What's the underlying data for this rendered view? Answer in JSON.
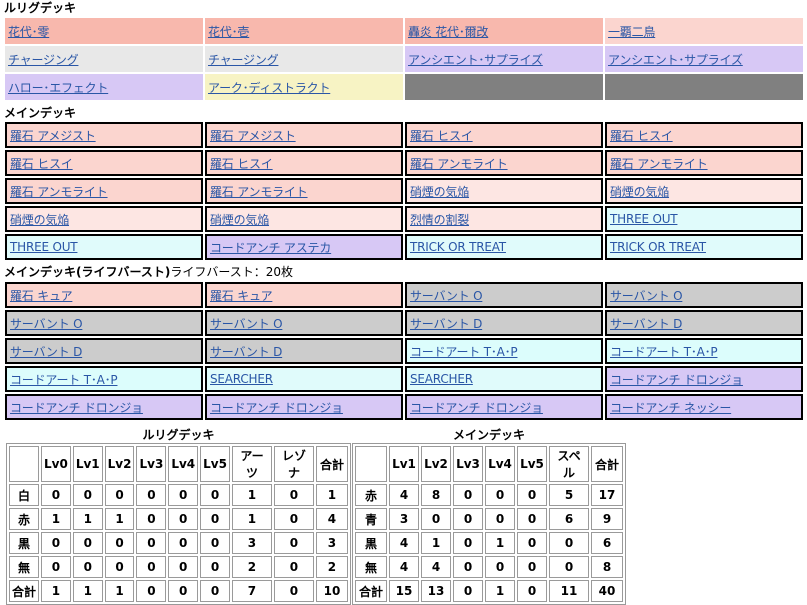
{
  "lrig": {
    "title": "ルリグデッキ",
    "rows": [
      [
        {
          "label": "花代･零",
          "color": "red"
        },
        {
          "label": "花代･壱",
          "color": "red"
        },
        {
          "label": "轟炎 花代･爾改",
          "color": "red"
        },
        {
          "label": "一覇二鳥",
          "color": "lred"
        }
      ],
      [
        {
          "label": "チャージング",
          "color": "white"
        },
        {
          "label": "チャージング",
          "color": "white"
        },
        {
          "label": "アンシエント･サプライズ",
          "color": "purple"
        },
        {
          "label": "アンシエント･サプライズ",
          "color": "purple"
        }
      ],
      [
        {
          "label": "ハロー･エフェクト",
          "color": "purple"
        },
        {
          "label": "アーク･ディストラクト",
          "color": "yellow"
        },
        {
          "label": "",
          "color": "gray"
        },
        {
          "label": "",
          "color": "gray"
        }
      ]
    ]
  },
  "main": {
    "title": "メインデッキ",
    "rows": [
      [
        {
          "label": "羅石 アメジスト",
          "color": "lred"
        },
        {
          "label": "羅石 アメジスト",
          "color": "lred"
        },
        {
          "label": "羅石 ヒスイ",
          "color": "lred"
        },
        {
          "label": "羅石 ヒスイ",
          "color": "lred"
        }
      ],
      [
        {
          "label": "羅石 ヒスイ",
          "color": "lred"
        },
        {
          "label": "羅石 ヒスイ",
          "color": "lred"
        },
        {
          "label": "羅石 アンモライト",
          "color": "lred"
        },
        {
          "label": "羅石 アンモライト",
          "color": "lred"
        }
      ],
      [
        {
          "label": "羅石 アンモライト",
          "color": "lred"
        },
        {
          "label": "羅石 アンモライト",
          "color": "lred"
        },
        {
          "label": "硝煙の気焔",
          "color": "pink"
        },
        {
          "label": "硝煙の気焔",
          "color": "pink"
        }
      ],
      [
        {
          "label": "硝煙の気焔",
          "color": "pink"
        },
        {
          "label": "硝煙の気焔",
          "color": "pink"
        },
        {
          "label": "烈情の割裂",
          "color": "pink"
        },
        {
          "label": "THREE OUT",
          "color": "lblue"
        }
      ],
      [
        {
          "label": "THREE OUT",
          "color": "lblue"
        },
        {
          "label": "コードアンチ アステカ",
          "color": "purple"
        },
        {
          "label": "TRICK OR TREAT",
          "color": "lblue"
        },
        {
          "label": "TRICK OR TREAT",
          "color": "lblue"
        }
      ]
    ]
  },
  "lb": {
    "title": "メインデッキ(ライフバースト)",
    "subtitle": "ライフバースト：20枚",
    "rows": [
      [
        {
          "label": "羅石 キュア",
          "color": "lred"
        },
        {
          "label": "羅石 キュア",
          "color": "lred"
        },
        {
          "label": "サーバント O",
          "color": "lgray"
        },
        {
          "label": "サーバント O",
          "color": "lgray"
        }
      ],
      [
        {
          "label": "サーバント O",
          "color": "lgray"
        },
        {
          "label": "サーバント O",
          "color": "lgray"
        },
        {
          "label": "サーバント D",
          "color": "lgray"
        },
        {
          "label": "サーバント D",
          "color": "lgray"
        }
      ],
      [
        {
          "label": "サーバント D",
          "color": "lgray"
        },
        {
          "label": "サーバント D",
          "color": "lgray"
        },
        {
          "label": "コードアート T･A･P",
          "color": "cyan"
        },
        {
          "label": "コードアート T･A･P",
          "color": "cyan"
        }
      ],
      [
        {
          "label": "コードアート T･A･P",
          "color": "cyan"
        },
        {
          "label": "SEARCHER",
          "color": "lblue"
        },
        {
          "label": "SEARCHER",
          "color": "lblue"
        },
        {
          "label": "コードアンチ ドロンジョ",
          "color": "purple"
        }
      ],
      [
        {
          "label": "コードアンチ ドロンジョ",
          "color": "purple"
        },
        {
          "label": "コードアンチ ドロンジョ",
          "color": "purple"
        },
        {
          "label": "コードアンチ ドロンジョ",
          "color": "purple"
        },
        {
          "label": "コードアンチ ネッシー",
          "color": "purple"
        }
      ]
    ]
  },
  "lrig_stats": {
    "caption": "ルリグデッキ",
    "headers": [
      "",
      "Lv0",
      "Lv1",
      "Lv2",
      "Lv3",
      "Lv4",
      "Lv5",
      "アーツ",
      "レゾナ",
      "合計"
    ],
    "rows": [
      [
        "白",
        "0",
        "0",
        "0",
        "0",
        "0",
        "0",
        "1",
        "0",
        "1"
      ],
      [
        "赤",
        "1",
        "1",
        "1",
        "0",
        "0",
        "0",
        "1",
        "0",
        "4"
      ],
      [
        "黒",
        "0",
        "0",
        "0",
        "0",
        "0",
        "0",
        "3",
        "0",
        "3"
      ],
      [
        "無",
        "0",
        "0",
        "0",
        "0",
        "0",
        "0",
        "2",
        "0",
        "2"
      ],
      [
        "合計",
        "1",
        "1",
        "1",
        "0",
        "0",
        "0",
        "7",
        "0",
        "10"
      ]
    ]
  },
  "main_stats": {
    "caption": "メインデッキ",
    "headers": [
      "",
      "Lv1",
      "Lv2",
      "Lv3",
      "Lv4",
      "Lv5",
      "スペル",
      "合計"
    ],
    "rows": [
      [
        "赤",
        "4",
        "8",
        "0",
        "0",
        "0",
        "5",
        "17"
      ],
      [
        "青",
        "3",
        "0",
        "0",
        "0",
        "0",
        "6",
        "9"
      ],
      [
        "黒",
        "4",
        "1",
        "0",
        "1",
        "0",
        "0",
        "6"
      ],
      [
        "無",
        "4",
        "4",
        "0",
        "0",
        "0",
        "0",
        "8"
      ],
      [
        "合計",
        "15",
        "13",
        "0",
        "1",
        "0",
        "11",
        "40"
      ]
    ]
  }
}
